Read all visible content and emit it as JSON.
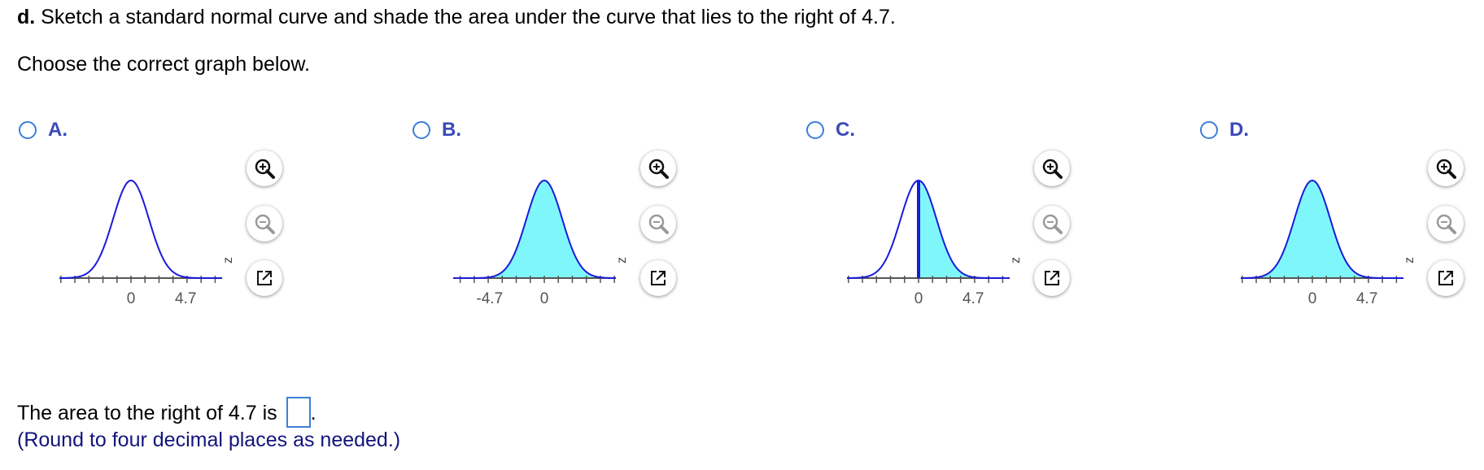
{
  "question": {
    "part_label": "d.",
    "text": "Sketch a standard normal curve and shade the area under the curve that lies to the right of 4.7.",
    "instruction": "Choose the correct graph below."
  },
  "options": [
    {
      "letter": "A.",
      "shade": "none",
      "tick_labels": [
        "0",
        "4.7"
      ],
      "axis_label": "z"
    },
    {
      "letter": "B.",
      "shade": "full",
      "tick_labels": [
        "-4.7",
        "0"
      ],
      "axis_label": "z"
    },
    {
      "letter": "C.",
      "shade": "right-of-zero",
      "tick_labels": [
        "0",
        "4.7"
      ],
      "axis_label": "z"
    },
    {
      "letter": "D.",
      "shade": "full",
      "tick_labels": [
        "0",
        "4.7"
      ],
      "axis_label": "z"
    }
  ],
  "tools": {
    "zoom_in": "zoom-in-icon",
    "zoom_out": "zoom-out-icon",
    "popout": "popout-icon"
  },
  "answer": {
    "prefix": "The area to the right of 4.7 is",
    "suffix": ".",
    "value": "",
    "hint": "(Round to four decimal places as needed.)"
  },
  "colors": {
    "curve": "#1a1adc",
    "shade": "#7ff7fa",
    "radio": "#3b7fd9",
    "option_letter": "#3a49b9",
    "hint": "#13147c"
  }
}
